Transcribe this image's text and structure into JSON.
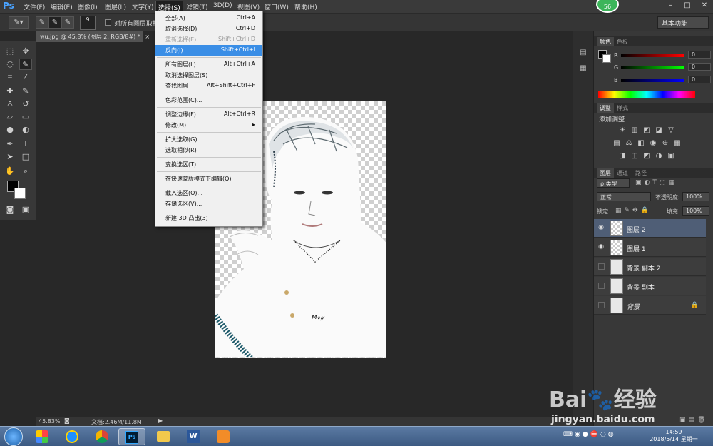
{
  "app": {
    "logo": "Ps"
  },
  "menu": [
    "文件(F)",
    "编辑(E)",
    "图像(I)",
    "图层(L)",
    "文字(Y)",
    "选择(S)",
    "滤镜(T)",
    "3D(D)",
    "视图(V)",
    "窗口(W)",
    "帮助(H)"
  ],
  "active_menu": "选择(S)",
  "badge": "56",
  "options_bar": {
    "brush_size": "9",
    "sample_all_layers": "对所有图层取样",
    "workspace": "基本功能"
  },
  "document": {
    "tab_title": "wu.jpg @ 45.8% (图层 2, RGB/8#) *",
    "close": "×"
  },
  "status": {
    "zoom": "45.83%",
    "doc_size": "文档:2.46M/11.8M"
  },
  "select_menu": [
    {
      "label": "全部(A)",
      "shortcut": "Ctrl+A"
    },
    {
      "label": "取消选择(D)",
      "shortcut": "Ctrl+D"
    },
    {
      "label": "重新选择(E)",
      "shortcut": "Shift+Ctrl+D",
      "disabled": true
    },
    {
      "label": "反向(I)",
      "shortcut": "Shift+Ctrl+I",
      "highlighted": true
    },
    {
      "separator": true
    },
    {
      "label": "所有图层(L)",
      "shortcut": "Alt+Ctrl+A"
    },
    {
      "label": "取消选择图层(S)",
      "shortcut": ""
    },
    {
      "label": "查找图层",
      "shortcut": "Alt+Shift+Ctrl+F"
    },
    {
      "separator": true
    },
    {
      "label": "色彩范围(C)...",
      "shortcut": ""
    },
    {
      "separator": true
    },
    {
      "label": "调整边缘(F)...",
      "shortcut": "Alt+Ctrl+R"
    },
    {
      "label": "修改(M)",
      "shortcut": "▸"
    },
    {
      "separator": true
    },
    {
      "label": "扩大选取(G)",
      "shortcut": ""
    },
    {
      "label": "选取相似(R)",
      "shortcut": ""
    },
    {
      "separator": true
    },
    {
      "label": "变换选区(T)",
      "shortcut": ""
    },
    {
      "separator": true
    },
    {
      "label": "在快速蒙版模式下编辑(Q)",
      "shortcut": ""
    },
    {
      "separator": true
    },
    {
      "label": "载入选区(O)...",
      "shortcut": ""
    },
    {
      "label": "存储选区(V)...",
      "shortcut": ""
    },
    {
      "separator": true
    },
    {
      "label": "新建 3D 凸出(3)",
      "shortcut": ""
    }
  ],
  "color_panel": {
    "tabs": [
      "颜色",
      "色板"
    ],
    "r": {
      "label": "R",
      "value": "0"
    },
    "g": {
      "label": "G",
      "value": "0"
    },
    "b": {
      "label": "B",
      "value": "0"
    }
  },
  "adjust_panel": {
    "tabs": [
      "调整",
      "样式"
    ],
    "title": "添加调整"
  },
  "layers_panel": {
    "tabs": [
      "图层",
      "通道",
      "路径"
    ],
    "filter": "ρ 类型",
    "blend_mode": "正常",
    "opacity_label": "不透明度:",
    "opacity": "100%",
    "lock_label": "锁定:",
    "fill_label": "填充:",
    "fill": "100%",
    "layers": [
      {
        "name": "图层 2",
        "visible": true,
        "selected": true,
        "thumb": "transparent"
      },
      {
        "name": "图层 1",
        "visible": true,
        "selected": false,
        "thumb": "transparent"
      },
      {
        "name": "背景 副本 2",
        "visible": false,
        "selected": false,
        "thumb": "photo"
      },
      {
        "name": "背景 副本",
        "visible": false,
        "selected": false,
        "thumb": "photo"
      },
      {
        "name": "背景",
        "visible": false,
        "selected": false,
        "thumb": "photo",
        "locked": true
      }
    ]
  },
  "taskbar": {
    "time": "14:59",
    "date": "2018/5/14 星期一"
  },
  "watermark": {
    "brand": "Bai🐾经验",
    "url": "jingyan.baidu.com"
  },
  "colors": {
    "accent": "#3a8ee6",
    "menu_bg": "#f0f0f0",
    "panel_bg": "#383838",
    "selected_layer": "#4f5e76"
  }
}
